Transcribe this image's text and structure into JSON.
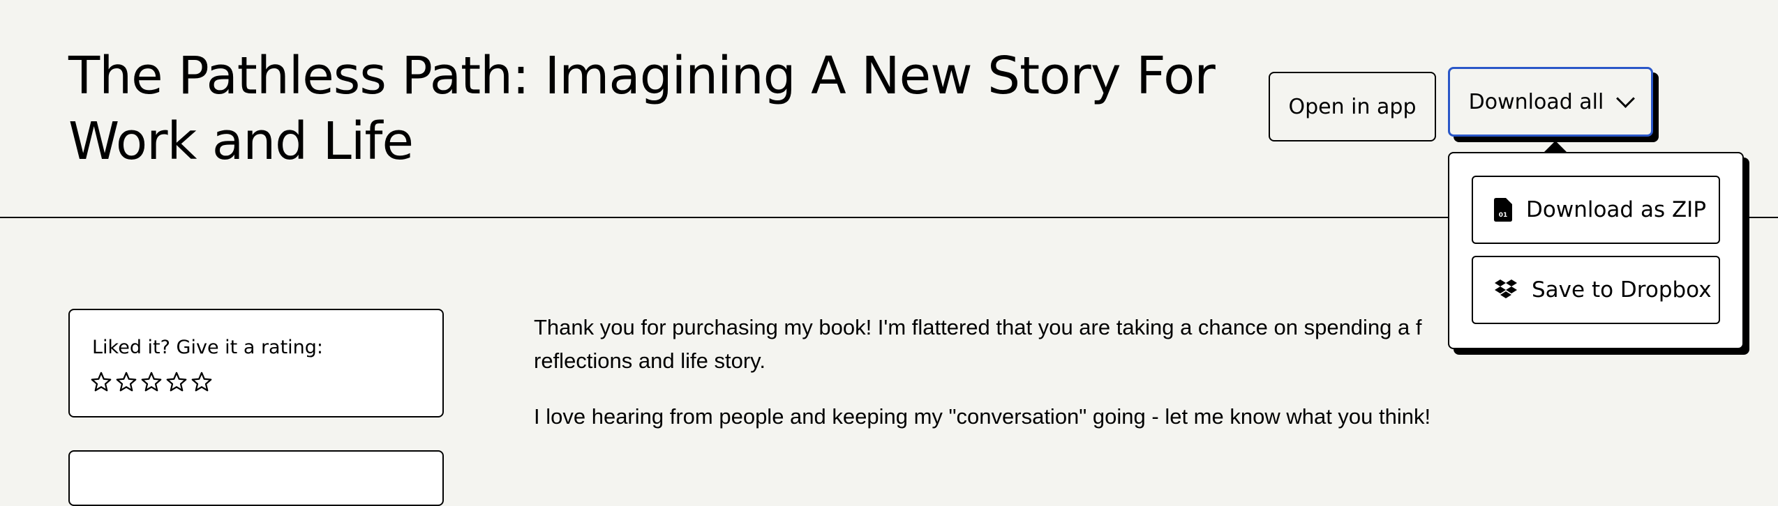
{
  "product": {
    "title": "The Pathless Path: Imagining A New Story For Work and Life"
  },
  "actions": {
    "open_in_app": "Open in app",
    "download_all": "Download all"
  },
  "download_menu": {
    "items": [
      {
        "label": "Download as ZIP",
        "icon": "zip-file-icon"
      },
      {
        "label": "Save to Dropbox",
        "icon": "dropbox-icon"
      }
    ]
  },
  "rating": {
    "prompt": "Liked it? Give it a rating:",
    "max_stars": 5,
    "current": 0
  },
  "message": {
    "paragraph1_line1": "Thank you for purchasing my book! I'm flattered that you are taking a chance on spending a f",
    "paragraph1_line2": "reflections and life story.",
    "paragraph2": "I love hearing from people and keeping my \"conversation\" going - let me know what you think!"
  },
  "colors": {
    "background": "#f4f4f0",
    "focus_accent": "#2a57c8",
    "card": "#ffffff",
    "text": "#000000"
  }
}
